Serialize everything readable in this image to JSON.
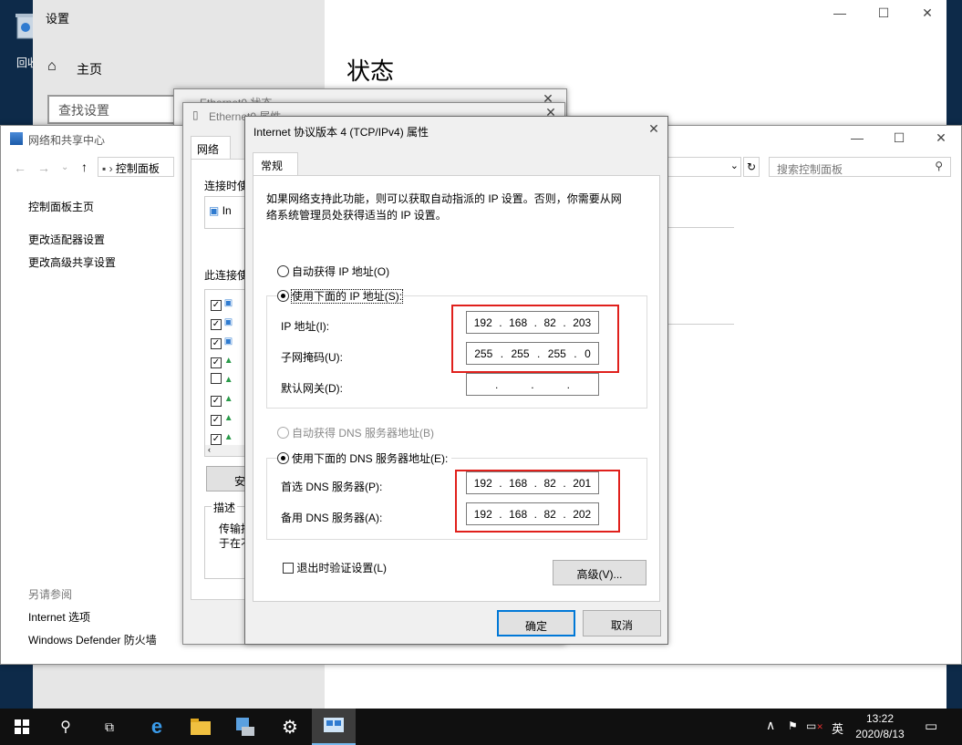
{
  "desktop": {
    "recycle_label": "回收"
  },
  "settings": {
    "title": "设置",
    "home": "主页",
    "search_placeholder": "查找设置",
    "heading": "状态"
  },
  "eth_status": {
    "title": "Ethernet0 状态"
  },
  "eth_props": {
    "title": "Ethernet0 属性",
    "tab": "网络",
    "connect_using": "连接时使",
    "adapter_prefix": "In",
    "items_label": "此连接使",
    "install_btn": "安",
    "desc_label": "描述",
    "desc_text1": "传输控",
    "desc_text2": "于在不"
  },
  "network_center": {
    "title": "网络和共享中心",
    "breadcrumb": "控制面板",
    "search_placeholder": "搜索控制面板",
    "sidebar_home": "控制面板主页",
    "sidebar_adapter": "更改适配器设置",
    "sidebar_sharing": "更改高级共享设置",
    "see_also": "另请参阅",
    "internet_options": "Internet 选项",
    "defender": "Windows Defender 防火墙"
  },
  "ipv4": {
    "title": "Internet 协议版本 4 (TCP/IPv4) 属性",
    "tab": "常规",
    "desc": "如果网络支持此功能，则可以获取自动指派的 IP 设置。否则，你需要从网络系统管理员处获得适当的 IP 设置。",
    "auto_ip": "自动获得 IP 地址(O)",
    "use_ip": "使用下面的 IP 地址(S):",
    "ip_label": "IP 地址(I):",
    "mask_label": "子网掩码(U):",
    "gateway_label": "默认网关(D):",
    "ip_value": [
      "192",
      "168",
      "82",
      "203"
    ],
    "mask_value": [
      "255",
      "255",
      "255",
      "0"
    ],
    "gateway_value": [
      "",
      "",
      "",
      ""
    ],
    "auto_dns": "自动获得 DNS 服务器地址(B)",
    "use_dns": "使用下面的 DNS 服务器地址(E):",
    "pref_dns_label": "首选 DNS 服务器(P):",
    "alt_dns_label": "备用 DNS 服务器(A):",
    "pref_dns": [
      "192",
      "168",
      "82",
      "201"
    ],
    "alt_dns": [
      "192",
      "168",
      "82",
      "202"
    ],
    "validate": "退出时验证设置(L)",
    "advanced": "高级(V)...",
    "ok": "确定",
    "cancel": "取消"
  },
  "taskbar": {
    "ime": "英",
    "time": "13:22",
    "date": "2020/8/13"
  },
  "colors": {
    "accent": "#0078d7",
    "highlight": "#e0201c",
    "taskbar": "#101010"
  }
}
